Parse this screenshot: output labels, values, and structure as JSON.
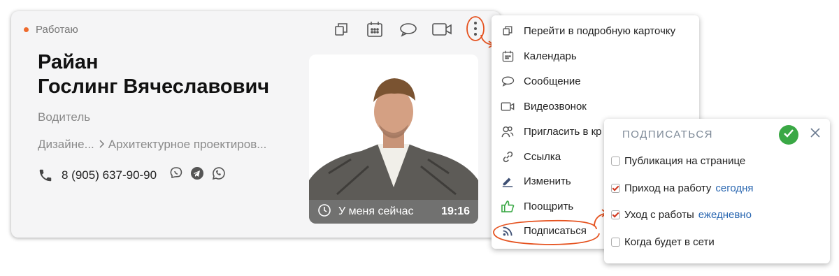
{
  "card": {
    "status": "Работаю",
    "name_line1": "Райан",
    "name_line2": "Гослинг Вячеславович",
    "position": "Водитель",
    "dept_1": "Дизайне...",
    "dept_2": "Архитектурное проектиров...",
    "phone": "8 (905) 637-90-90",
    "photo_caption": "У меня сейчас",
    "photo_time": "19:16"
  },
  "actions": [
    "copy-icon",
    "calendar-icon",
    "chat-icon",
    "video-icon",
    "more-vertical-icon"
  ],
  "menu": {
    "items": [
      {
        "label": "Перейти в подробную карточку",
        "icon": "copy-icon"
      },
      {
        "label": "Календарь",
        "icon": "calendar-icon"
      },
      {
        "label": "Сообщение",
        "icon": "chat-icon"
      },
      {
        "label": "Видеозвонок",
        "icon": "video-icon"
      },
      {
        "label": "Пригласить в кр",
        "icon": "invite-icon"
      },
      {
        "label": "Ссылка",
        "icon": "link-icon"
      },
      {
        "label": "Изменить",
        "icon": "pencil-icon"
      },
      {
        "label": "Поощрить",
        "icon": "thumbs-up-icon"
      },
      {
        "label": "Подписаться",
        "icon": "rss-icon"
      }
    ]
  },
  "subscribe": {
    "title": "ПОДПИСАТЬСЯ",
    "options": [
      {
        "label": "Публикация на странице",
        "checked": false,
        "link": ""
      },
      {
        "label": "Приход на работу",
        "checked": true,
        "link": "сегодня"
      },
      {
        "label": "Уход с работы",
        "checked": true,
        "link": "ежедневно"
      },
      {
        "label": "Когда будет в сети",
        "checked": false,
        "link": ""
      }
    ]
  },
  "colors": {
    "accent": "#e5521f",
    "status_dot": "#ee6a2c",
    "ok": "#3aa845",
    "link": "#2a67b1"
  }
}
